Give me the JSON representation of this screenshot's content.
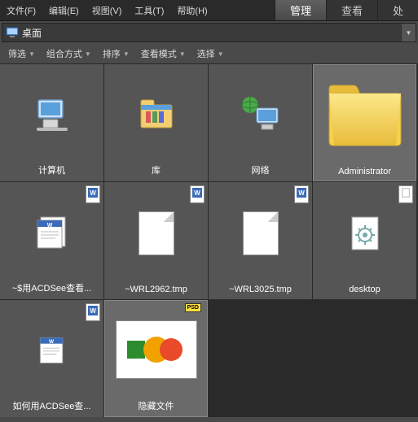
{
  "menu": {
    "file": "文件(F)",
    "edit": "编辑(E)",
    "view": "视图(V)",
    "tools": "工具(T)",
    "help": "帮助(H)"
  },
  "tabs": {
    "manage": "管理",
    "view": "查看",
    "process": "处"
  },
  "path": {
    "label": "桌面"
  },
  "toolbar": {
    "filter": "筛选",
    "group": "组合方式",
    "sort": "排序",
    "viewmode": "查看模式",
    "select": "选择"
  },
  "items": [
    {
      "label": "计算机",
      "type": "computer"
    },
    {
      "label": "库",
      "type": "library"
    },
    {
      "label": "网络",
      "type": "network"
    },
    {
      "label": "Administrator",
      "type": "folder",
      "selected": true
    },
    {
      "label": "~$用ACDSee查看...",
      "type": "word",
      "badge": "word"
    },
    {
      "label": "~WRL2962.tmp",
      "type": "page",
      "badge": "word"
    },
    {
      "label": "~WRL3025.tmp",
      "type": "page",
      "badge": "word"
    },
    {
      "label": "desktop",
      "type": "gear",
      "badge": "plain"
    },
    {
      "label": "如何用ACDSee查...",
      "type": "word",
      "badge": "word"
    },
    {
      "label": "隐藏文件",
      "type": "psd",
      "badge": "psd",
      "selected": true
    }
  ]
}
